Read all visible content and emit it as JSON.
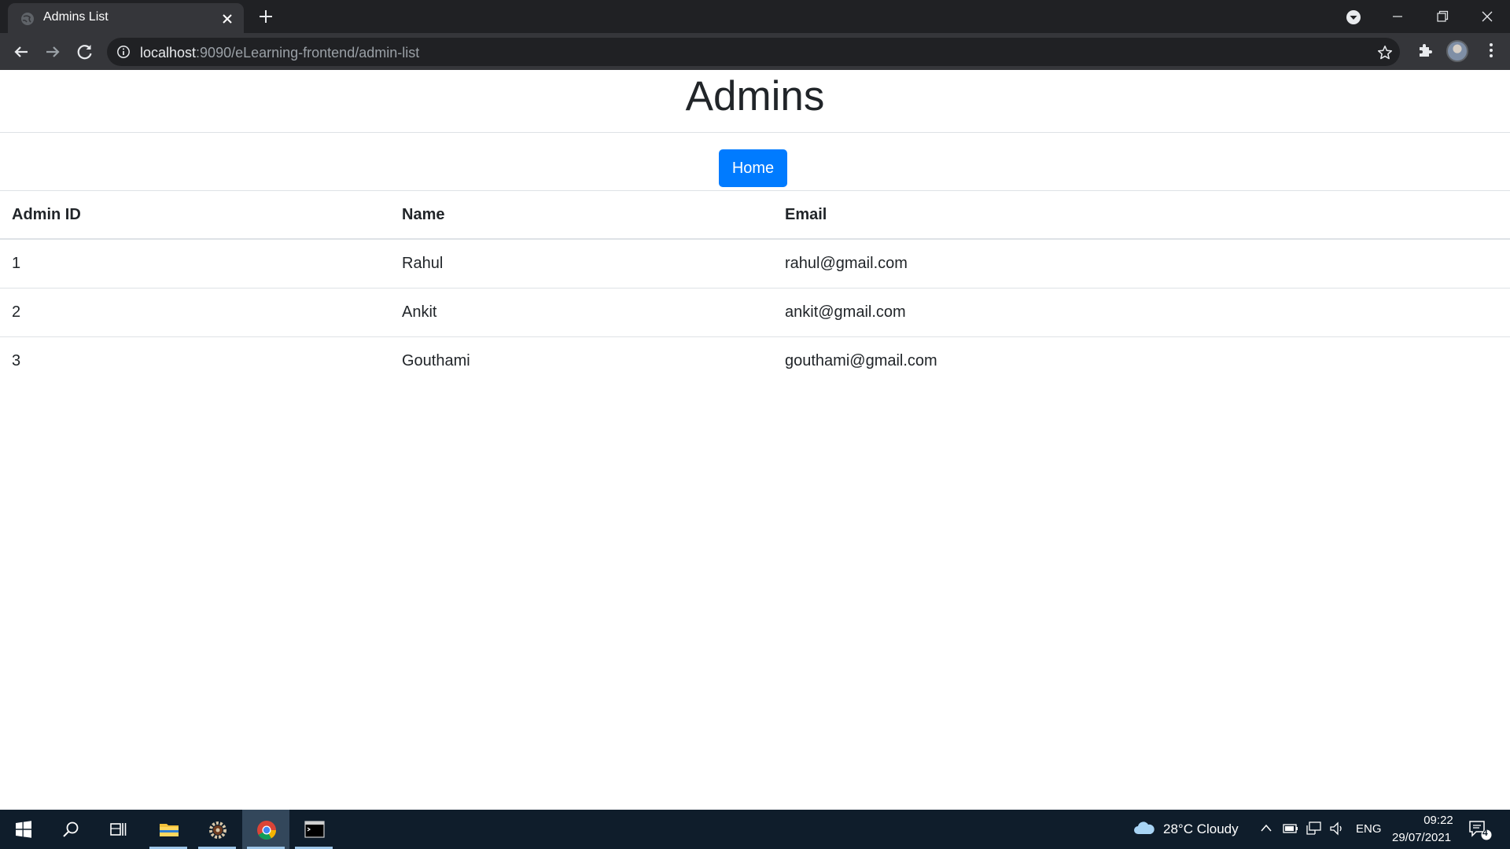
{
  "browser": {
    "tab_title": "Admins List",
    "url_host": "localhost",
    "url_rest": ":9090/eLearning-frontend/admin-list"
  },
  "page": {
    "title": "Admins",
    "home_button": "Home"
  },
  "table": {
    "headers": [
      "Admin ID",
      "Name",
      "Email"
    ],
    "rows": [
      [
        "1",
        "Rahul",
        "rahul@gmail.com"
      ],
      [
        "2",
        "Ankit",
        "ankit@gmail.com"
      ],
      [
        "3",
        "Gouthami",
        "gouthami@gmail.com"
      ]
    ]
  },
  "taskbar": {
    "weather": "28°C  Cloudy",
    "language": "ENG",
    "time": "09:22",
    "date": "29/07/2021",
    "notification_count": "4"
  },
  "colors": {
    "accent": "#007bff",
    "tab_active": "#35363a",
    "tabbar": "#202124",
    "taskbar": "#0f1d2b"
  }
}
